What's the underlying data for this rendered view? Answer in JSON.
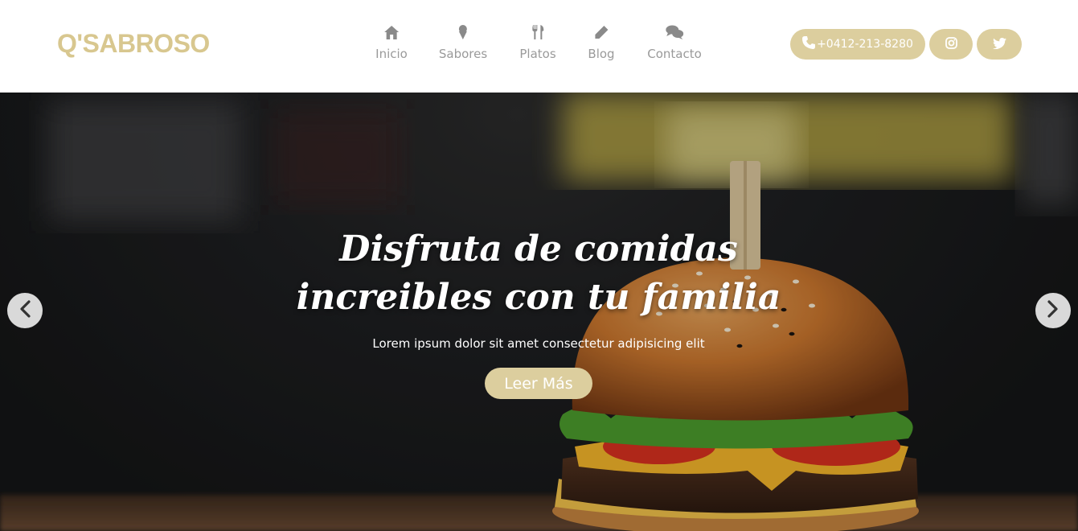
{
  "brand": {
    "logo_text": "Q'SABROSO"
  },
  "nav": {
    "items": [
      {
        "label": "Inicio",
        "icon": "home-icon"
      },
      {
        "label": "Sabores",
        "icon": "ice-cream-icon"
      },
      {
        "label": "Platos",
        "icon": "utensils-icon"
      },
      {
        "label": "Blog",
        "icon": "pencil-icon"
      },
      {
        "label": "Contacto",
        "icon": "chat-bubbles-icon"
      }
    ]
  },
  "contact": {
    "phone": "+0412-213-8280",
    "phone_icon": "phone-icon",
    "instagram_icon": "instagram-icon",
    "twitter_icon": "twitter-icon"
  },
  "hero": {
    "title": "Disfruta de comidas increibles con tu familia",
    "subtitle": "Lorem ipsum dolor sit amet consectetur adipisicing elit",
    "button_label": "Leer Más",
    "prev_icon": "chevron-left-icon",
    "next_icon": "chevron-right-icon",
    "image": "burger-photo"
  },
  "colors": {
    "accent": "#dcce9e",
    "logo": "#d8c78f",
    "nav_text": "#9a9a9a"
  }
}
